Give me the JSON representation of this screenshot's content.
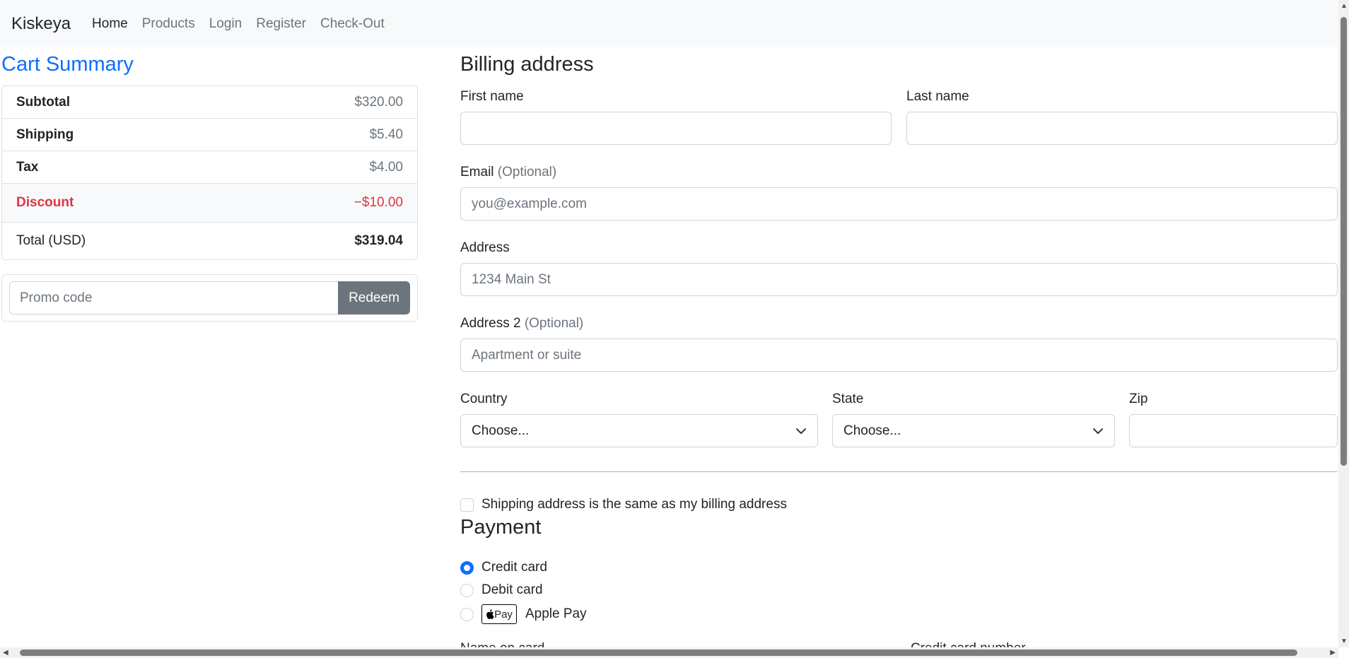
{
  "navbar": {
    "brand": "Kiskeya",
    "links": [
      "Home",
      "Products",
      "Login",
      "Register",
      "Check-Out"
    ]
  },
  "cart": {
    "title": "Cart Summary",
    "rows": [
      {
        "label": "Subtotal",
        "value": "$320.00"
      },
      {
        "label": "Shipping",
        "value": "$5.40"
      },
      {
        "label": "Tax",
        "value": "$4.00"
      },
      {
        "label": "Discount",
        "value": "−$10.00"
      },
      {
        "label": "Total (USD)",
        "value": "$319.04"
      }
    ],
    "promo_placeholder": "Promo code",
    "redeem_label": "Redeem"
  },
  "billing": {
    "title": "Billing address",
    "first_name_label": "First name",
    "last_name_label": "Last name",
    "email_label": "Email",
    "optional": "(Optional)",
    "email_placeholder": "you@example.com",
    "address_label": "Address",
    "address_placeholder": "1234 Main St",
    "address2_label": "Address 2",
    "address2_placeholder": "Apartment or suite",
    "country_label": "Country",
    "country_value": "Choose...",
    "state_label": "State",
    "state_value": "Choose...",
    "zip_label": "Zip",
    "same_address_label": "Shipping address is the same as my billing address"
  },
  "payment": {
    "title": "Payment",
    "options": [
      "Credit card",
      "Debit card",
      "Apple Pay"
    ],
    "apple_pay_badge": "Pay",
    "cutoff_labels": [
      "Name on card",
      "Credit card number"
    ]
  },
  "colors": {
    "primary": "#0d6efd",
    "danger": "#dc3545",
    "secondary": "#6c757d"
  }
}
